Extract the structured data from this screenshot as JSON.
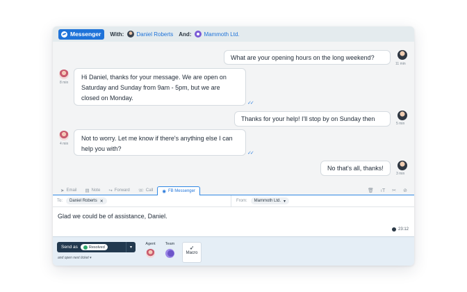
{
  "header": {
    "channel": "Messenger",
    "with_label": "With:",
    "with_name": "Daniel Roberts",
    "and_label": "And:",
    "and_name": "Mammoth Ltd."
  },
  "messages": [
    {
      "direction": "out",
      "text": "What are your opening hours on the long weekend?",
      "time": "11 min"
    },
    {
      "direction": "in",
      "text": "Hi Daniel, thanks for your message. We are open on Saturday and Sunday from 9am - 5pm, but we are closed on Monday.",
      "time": "8 min"
    },
    {
      "direction": "out",
      "text": "Thanks for your help! I'll stop by on Sunday then",
      "time": "5 min"
    },
    {
      "direction": "in",
      "text": "Not to worry. Let me know if there's anything else I can help you with?",
      "time": "4 min"
    },
    {
      "direction": "out",
      "text": "No that's all, thanks!",
      "time": "3 min"
    }
  ],
  "tabs": [
    {
      "label": "Email",
      "icon": "send-icon"
    },
    {
      "label": "Note",
      "icon": "note-icon"
    },
    {
      "label": "Forward",
      "icon": "forward-icon"
    },
    {
      "label": "Call",
      "icon": "phone-icon"
    },
    {
      "label": "FB Messenger",
      "icon": "messenger-icon",
      "active": true
    }
  ],
  "compose": {
    "to_label": "To:",
    "to_value": "Daniel Roberts",
    "from_label": "From:",
    "from_value": "Mammoth Ltd.",
    "body": "Glad we could be of assistance, Daniel.",
    "timestamp": "23:12"
  },
  "footer": {
    "send_label": "Send as",
    "status": "Resolved",
    "next_ticket": "and open next ticket",
    "agent_label": "Agent",
    "team_label": "Team",
    "macro_label": "Macro"
  },
  "colors": {
    "accent": "#1f73d9",
    "send_button": "#22394f",
    "resolved": "#2da66b"
  }
}
